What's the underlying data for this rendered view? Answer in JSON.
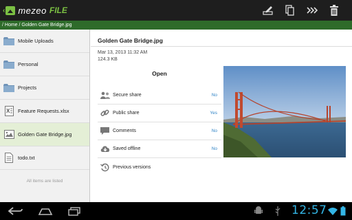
{
  "app": {
    "logo_text": "mezeo",
    "logo_badge": "FILE"
  },
  "toolbar": {
    "actions": [
      {
        "name": "edit-icon"
      },
      {
        "name": "copy-icon"
      },
      {
        "name": "move-icon"
      },
      {
        "name": "delete-icon"
      }
    ]
  },
  "breadcrumb": "/ Home / Golden Gate Bridge.jpg",
  "sidebar": {
    "items": [
      {
        "label": "Mobile Uploads",
        "icon": "folder-icon"
      },
      {
        "label": "Personal",
        "icon": "folder-icon"
      },
      {
        "label": "Projects",
        "icon": "folder-icon"
      },
      {
        "label": "Feature Requests.xlsx",
        "icon": "excel-file-icon"
      },
      {
        "label": "Golden Gate Bridge.jpg",
        "icon": "image-file-icon",
        "selected": true
      },
      {
        "label": "todo.txt",
        "icon": "text-file-icon"
      }
    ],
    "footer": "All items are listed"
  },
  "detail": {
    "title": "Golden Gate Bridge.jpg",
    "date": "Mar 13, 2013 11:32 AM",
    "size": "124.3 KB",
    "open_label": "Open",
    "rows": [
      {
        "label": "Secure share",
        "value": "No",
        "icon": "secure-share-icon"
      },
      {
        "label": "Public share",
        "value": "Yes",
        "icon": "link-icon"
      },
      {
        "label": "Comments",
        "value": "No",
        "icon": "comment-icon"
      },
      {
        "label": "Saved offline",
        "value": "No",
        "icon": "download-icon"
      },
      {
        "label": "Previous versions",
        "value": "",
        "icon": "history-icon"
      }
    ]
  },
  "system": {
    "clock": "12:57"
  },
  "colors": {
    "accent_green": "#7bc043",
    "breadcrumb_bg": "#2e6b2a",
    "link_blue": "#2f83c6",
    "clock_blue": "#33b5e5"
  }
}
